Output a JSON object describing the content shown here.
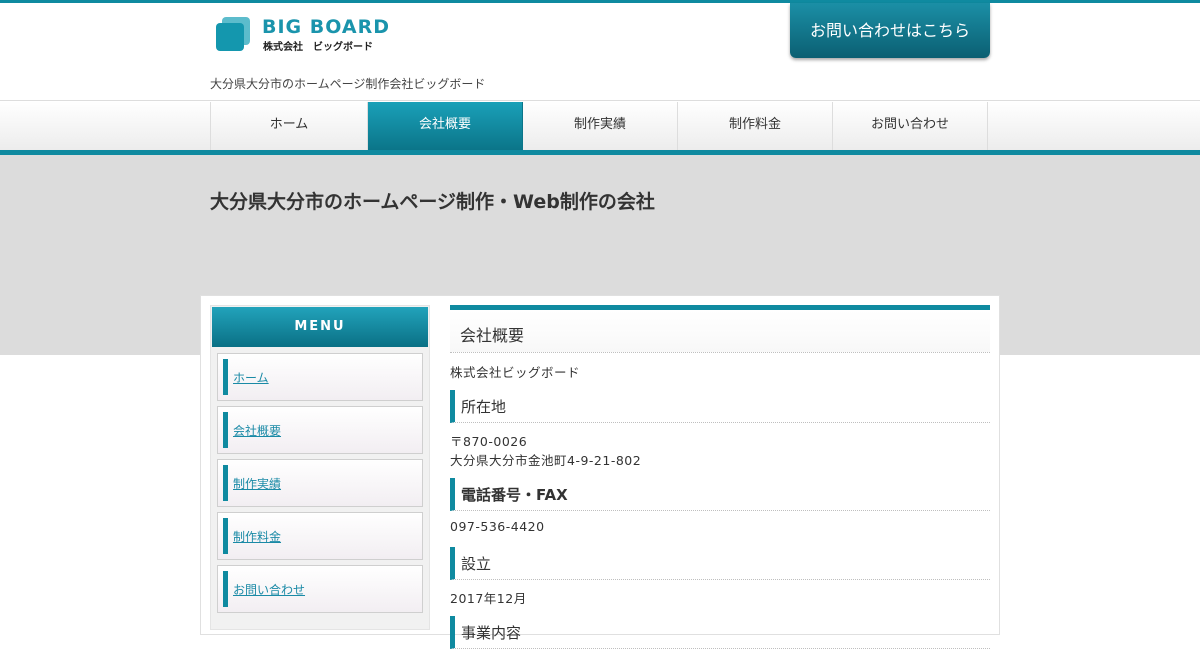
{
  "header": {
    "logo_name": "BIG  BOARD",
    "logo_sub": "株式会社　ビッグボード",
    "tagline": "大分県大分市のホームページ制作会社ビッグボード",
    "contact_button": "お問い合わせはこちら"
  },
  "nav": {
    "items": [
      {
        "label": "ホーム",
        "active": false
      },
      {
        "label": "会社概要",
        "active": true
      },
      {
        "label": "制作実績",
        "active": false
      },
      {
        "label": "制作料金",
        "active": false
      },
      {
        "label": "お問い合わせ",
        "active": false
      }
    ]
  },
  "hero": {
    "title": "大分県大分市のホームページ制作・Web制作の会社"
  },
  "sidebar": {
    "menu_title": "MENU",
    "items": [
      "ホーム",
      "会社概要",
      "制作実績",
      "制作料金",
      "お問い合わせ"
    ]
  },
  "main": {
    "heading": "会社概要",
    "company_name": "株式会社ビッグボード",
    "sections": [
      {
        "title": "所在地",
        "lines": [
          "〒870-0026",
          "大分県大分市金池町4-9-21-802"
        ]
      },
      {
        "title": "電話番号・FAX",
        "lines": [
          "097-536-4420"
        ]
      },
      {
        "title": "設立",
        "lines": [
          "2017年12月"
        ]
      },
      {
        "title": "事業内容",
        "lines": []
      }
    ]
  },
  "colors": {
    "accent": "#0f8aa0",
    "hero_bg": "#dcdcdc"
  }
}
